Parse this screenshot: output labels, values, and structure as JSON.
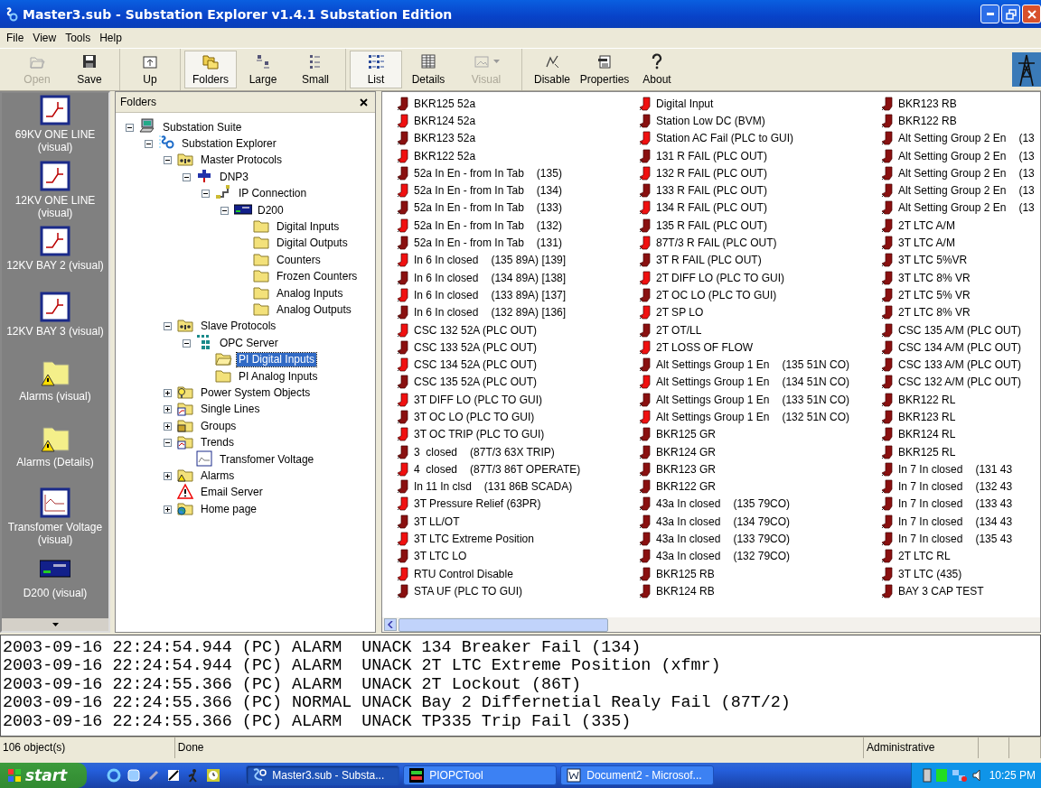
{
  "window": {
    "title": "Master3.sub - Substation Explorer v1.4.1 Substation Edition"
  },
  "menu": [
    "File",
    "View",
    "Tools",
    "Help"
  ],
  "toolbar": [
    [
      {
        "label": "Open",
        "kind": "open",
        "disabled": true,
        "pressed": false,
        "dropdown": false
      },
      {
        "label": "Save",
        "kind": "save",
        "disabled": false,
        "pressed": false,
        "dropdown": false
      }
    ],
    [
      {
        "label": "Up",
        "kind": "up",
        "disabled": false,
        "pressed": false,
        "dropdown": false
      }
    ],
    [
      {
        "label": "Folders",
        "kind": "folders",
        "disabled": false,
        "pressed": true,
        "dropdown": false
      },
      {
        "label": "Large",
        "kind": "large",
        "disabled": false,
        "pressed": false,
        "dropdown": false
      },
      {
        "label": "Small",
        "kind": "small",
        "disabled": false,
        "pressed": false,
        "dropdown": false
      }
    ],
    [
      {
        "label": "List",
        "kind": "list",
        "disabled": false,
        "pressed": true,
        "dropdown": false
      },
      {
        "label": "Details",
        "kind": "details",
        "disabled": false,
        "pressed": false,
        "dropdown": false
      },
      {
        "label": "Visual",
        "kind": "visual",
        "disabled": true,
        "pressed": false,
        "dropdown": true
      }
    ],
    [
      {
        "label": "Disable",
        "kind": "disable",
        "disabled": false,
        "pressed": false,
        "dropdown": false
      },
      {
        "label": "Properties",
        "kind": "properties",
        "disabled": false,
        "pressed": false,
        "dropdown": false
      },
      {
        "label": "About",
        "kind": "about",
        "disabled": false,
        "pressed": false,
        "dropdown": false
      }
    ]
  ],
  "shortcuts": [
    {
      "label": "69KV ONE LINE (visual)",
      "kind": "visual"
    },
    {
      "label": "12KV ONE LINE (visual)",
      "kind": "visual"
    },
    {
      "label": "12KV BAY 2 (visual)",
      "kind": "visual"
    },
    {
      "label": "12KV BAY 3 (visual)",
      "kind": "visual"
    },
    {
      "label": "Alarms (visual)",
      "kind": "alarm"
    },
    {
      "label": "Alarms (Details)",
      "kind": "alarm"
    },
    {
      "label": "Transfomer Voltage (visual)",
      "kind": "trend"
    },
    {
      "label": "D200 (visual)",
      "kind": "rtu"
    }
  ],
  "folders": {
    "title": "Folders",
    "tree": [
      {
        "label": "Substation Suite",
        "kind": "computer",
        "expanded": true,
        "selected": false,
        "children": [
          {
            "label": "Substation Explorer",
            "kind": "app",
            "expanded": true,
            "selected": false,
            "children": [
              {
                "label": "Master Protocols",
                "kind": "protocols",
                "expanded": true,
                "selected": false,
                "children": [
                  {
                    "label": "DNP3",
                    "kind": "plug",
                    "expanded": true,
                    "selected": false,
                    "children": [
                      {
                        "label": "IP Connection",
                        "kind": "network",
                        "expanded": true,
                        "selected": false,
                        "children": [
                          {
                            "label": "D200",
                            "kind": "rtu",
                            "expanded": true,
                            "selected": false,
                            "children": [
                              {
                                "label": "Digital Inputs",
                                "kind": "folder",
                                "selected": false
                              },
                              {
                                "label": "Digital Outputs",
                                "kind": "folder",
                                "selected": false
                              },
                              {
                                "label": "Counters",
                                "kind": "folder",
                                "selected": false
                              },
                              {
                                "label": "Frozen Counters",
                                "kind": "folder",
                                "selected": false
                              },
                              {
                                "label": "Analog Inputs",
                                "kind": "folder",
                                "selected": false
                              },
                              {
                                "label": "Analog Outputs",
                                "kind": "folder",
                                "selected": false
                              }
                            ]
                          }
                        ]
                      }
                    ]
                  }
                ]
              },
              {
                "label": "Slave Protocols",
                "kind": "protocols",
                "expanded": true,
                "selected": false,
                "children": [
                  {
                    "label": "OPC Server",
                    "kind": "grid",
                    "expanded": true,
                    "selected": false,
                    "children": [
                      {
                        "label": "PI Digital Inputs",
                        "kind": "folder",
                        "selected": true
                      },
                      {
                        "label": "PI Analog Inputs",
                        "kind": "folder",
                        "selected": false
                      }
                    ]
                  }
                ]
              },
              {
                "label": "Power System Objects",
                "kind": "objects",
                "expanded": false,
                "selected": false
              },
              {
                "label": "Single Lines",
                "kind": "lines",
                "expanded": false,
                "selected": false
              },
              {
                "label": "Groups",
                "kind": "groups",
                "expanded": false,
                "selected": false
              },
              {
                "label": "Trends",
                "kind": "trends",
                "expanded": true,
                "selected": false,
                "children": [
                  {
                    "label": "Transfomer Voltage",
                    "kind": "trend",
                    "selected": false
                  }
                ]
              },
              {
                "label": "Alarms",
                "kind": "alarms",
                "expanded": false,
                "selected": false
              },
              {
                "label": "Email Server",
                "kind": "email",
                "selected": false
              },
              {
                "label": "Home page",
                "kind": "web",
                "expanded": false,
                "selected": false
              }
            ]
          }
        ]
      }
    ]
  },
  "list": {
    "columns": [
      [
        {
          "label": "BKR125 52a",
          "lit": false
        },
        {
          "label": "BKR124 52a",
          "lit": true
        },
        {
          "label": "BKR123 52a",
          "lit": false
        },
        {
          "label": "BKR122 52a",
          "lit": true
        },
        {
          "label": "52a In En - from In Tab",
          "suffix": "(135)",
          "lit": false
        },
        {
          "label": "52a In En - from In Tab",
          "suffix": "(134)",
          "lit": true
        },
        {
          "label": "52a In En - from In Tab",
          "suffix": "(133)",
          "lit": false
        },
        {
          "label": "52a In En - from In Tab",
          "suffix": "(132)",
          "lit": true
        },
        {
          "label": "52a In En - from In Tab",
          "suffix": "(131)",
          "lit": false
        },
        {
          "label": "In 6 In closed",
          "suffix": "(135 89A) [139]",
          "lit": true
        },
        {
          "label": "In 6 In closed",
          "suffix": "(134 89A) [138]",
          "lit": false
        },
        {
          "label": "In 6 In closed",
          "suffix": "(133 89A) [137]",
          "lit": true
        },
        {
          "label": "In 6 In closed",
          "suffix": "(132 89A) [136]",
          "lit": false
        },
        {
          "label": "CSC 132 52A (PLC OUT)",
          "lit": true
        },
        {
          "label": "CSC 133 52A (PLC OUT)",
          "lit": false
        },
        {
          "label": "CSC 134 52A (PLC OUT)",
          "lit": true
        },
        {
          "label": "CSC 135 52A (PLC OUT)",
          "lit": false
        },
        {
          "label": "3T DIFF LO (PLC TO GUI)",
          "lit": true
        },
        {
          "label": "3T OC LO (PLC TO GUI)",
          "lit": false
        },
        {
          "label": "3T OC TRIP (PLC TO GUI)",
          "lit": true
        },
        {
          "label": "3  closed",
          "suffix": "(87T/3 63X TRIP)",
          "lit": false
        },
        {
          "label": "4  closed",
          "suffix": "(87T/3 86T OPERATE)",
          "lit": true
        },
        {
          "label": "In 11 In clsd",
          "suffix": "(131 86B SCADA)",
          "lit": false
        },
        {
          "label": "3T Pressure Relief (63PR)",
          "lit": true
        },
        {
          "label": "3T LL/OT",
          "lit": false
        },
        {
          "label": "3T LTC Extreme Position",
          "lit": true
        },
        {
          "label": "3T LTC LO",
          "lit": false
        },
        {
          "label": "RTU Control Disable",
          "lit": true
        },
        {
          "label": "STA UF (PLC TO GUI)",
          "lit": false
        }
      ],
      [
        {
          "label": "Digital Input",
          "lit": true
        },
        {
          "label": "Station Low DC (BVM)",
          "lit": false
        },
        {
          "label": "Station AC Fail (PLC to GUI)",
          "lit": true
        },
        {
          "label": "131 R FAIL (PLC OUT)",
          "lit": false
        },
        {
          "label": "132 R FAIL (PLC OUT)",
          "lit": true
        },
        {
          "label": "133 R FAIL (PLC OUT)",
          "lit": false
        },
        {
          "label": "134 R FAIL (PLC OUT)",
          "lit": true
        },
        {
          "label": "135 R FAIL (PLC OUT)",
          "lit": false
        },
        {
          "label": "87T/3 R FAIL (PLC OUT)",
          "lit": true
        },
        {
          "label": "3T R FAIL (PLC OUT)",
          "lit": false
        },
        {
          "label": "2T DIFF LO (PLC TO GUI)",
          "lit": true
        },
        {
          "label": "2T OC LO (PLC TO GUI)",
          "lit": false
        },
        {
          "label": "2T SP LO",
          "lit": true
        },
        {
          "label": "2T OT/LL",
          "lit": false
        },
        {
          "label": "2T LOSS OF FLOW",
          "lit": true
        },
        {
          "label": "Alt Settings Group 1 En",
          "suffix": "(135 51N CO)",
          "lit": false
        },
        {
          "label": "Alt Settings Group 1 En",
          "suffix": "(134 51N CO)",
          "lit": true
        },
        {
          "label": "Alt Settings Group 1 En",
          "suffix": "(133 51N CO)",
          "lit": false
        },
        {
          "label": "Alt Settings Group 1 En",
          "suffix": "(132 51N CO)",
          "lit": true
        },
        {
          "label": "BKR125 GR",
          "lit": false
        },
        {
          "label": "BKR124 GR",
          "lit": false
        },
        {
          "label": "BKR123 GR",
          "lit": false
        },
        {
          "label": "BKR122 GR",
          "lit": false
        },
        {
          "label": "43a In closed",
          "suffix": "(135 79CO)",
          "lit": false
        },
        {
          "label": "43a In closed",
          "suffix": "(134 79CO)",
          "lit": false
        },
        {
          "label": "43a In closed",
          "suffix": "(133 79CO)",
          "lit": false
        },
        {
          "label": "43a In closed",
          "suffix": "(132 79CO)",
          "lit": false
        },
        {
          "label": "BKR125 RB",
          "lit": false
        },
        {
          "label": "BKR124 RB",
          "lit": false
        }
      ],
      [
        {
          "label": "BKR123 RB",
          "lit": false
        },
        {
          "label": "BKR122 RB",
          "lit": false
        },
        {
          "label": "Alt Setting Group 2 En",
          "suffix": "(13",
          "lit": false
        },
        {
          "label": "Alt Setting Group 2 En",
          "suffix": "(13",
          "lit": false
        },
        {
          "label": "Alt Setting Group 2 En",
          "suffix": "(13",
          "lit": false
        },
        {
          "label": "Alt Setting Group 2 En",
          "suffix": "(13",
          "lit": false
        },
        {
          "label": "Alt Setting Group 2 En",
          "suffix": "(13",
          "lit": false
        },
        {
          "label": "2T LTC A/M",
          "lit": false
        },
        {
          "label": "3T LTC A/M",
          "lit": false
        },
        {
          "label": "3T LTC 5%VR",
          "lit": false
        },
        {
          "label": "3T LTC 8% VR",
          "lit": false
        },
        {
          "label": "2T LTC 5% VR",
          "lit": false
        },
        {
          "label": "2T LTC 8% VR",
          "lit": false
        },
        {
          "label": "CSC 135 A/M (PLC OUT)",
          "lit": false
        },
        {
          "label": "CSC 134 A/M (PLC OUT)",
          "lit": false
        },
        {
          "label": "CSC 133 A/M (PLC OUT)",
          "lit": false
        },
        {
          "label": "CSC 132 A/M (PLC OUT)",
          "lit": false
        },
        {
          "label": "BKR122 RL",
          "lit": false
        },
        {
          "label": "BKR123 RL",
          "lit": false
        },
        {
          "label": "BKR124 RL",
          "lit": false
        },
        {
          "label": "BKR125 RL",
          "lit": false
        },
        {
          "label": "In 7 In closed",
          "suffix": "(131 43",
          "lit": false
        },
        {
          "label": "In 7 In closed",
          "suffix": "(132 43",
          "lit": false
        },
        {
          "label": "In 7 In closed",
          "suffix": "(133 43",
          "lit": false
        },
        {
          "label": "In 7 In closed",
          "suffix": "(134 43",
          "lit": false
        },
        {
          "label": "In 7 In closed",
          "suffix": "(135 43",
          "lit": false
        },
        {
          "label": "2T LTC RL",
          "lit": false
        },
        {
          "label": "3T LTC (435)",
          "lit": false
        },
        {
          "label": "BAY 3 CAP TEST",
          "lit": false
        }
      ]
    ]
  },
  "log": [
    "2003-09-16 22:24:54.944 (PC) ALARM  UNACK 134 Breaker Fail (134)",
    "2003-09-16 22:24:54.944 (PC) ALARM  UNACK 2T LTC Extreme Position (xfmr)",
    "2003-09-16 22:24:55.366 (PC) ALARM  UNACK 2T Lockout (86T)",
    "2003-09-16 22:24:55.366 (PC) NORMAL UNACK Bay 2 Differnetial Realy Fail (87T/2)",
    "2003-09-16 22:24:55.366 (PC) ALARM  UNACK TP335 Trip Fail (335)"
  ],
  "status_bar": [
    "106 object(s)",
    "Done",
    "Administrative"
  ],
  "taskbar": {
    "start": "start",
    "tasks": [
      {
        "label": "Master3.sub - Substa...",
        "kind": "app",
        "selected": true
      },
      {
        "label": "PIOPCTool",
        "kind": "tool",
        "selected": false
      },
      {
        "label": "Document2 - Microsof...",
        "kind": "document",
        "selected": false
      }
    ],
    "clock": "10:25 PM"
  }
}
